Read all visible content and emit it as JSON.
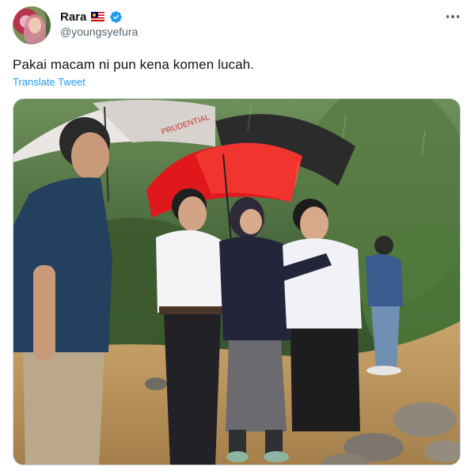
{
  "user": {
    "display_name": "Rara",
    "handle": "@youngsyefura",
    "flag_icon": "malaysia-flag-icon",
    "verified_icon": "verified-badge-icon",
    "verified_color": "#1d9bf0"
  },
  "tweet": {
    "text": "Pakai macam ni pun kena komen lucah.",
    "translate_label": "Translate Tweet"
  },
  "media": {
    "umbrella_brand_text": "PRUDENTIAL"
  },
  "colors": {
    "link": "#1d9bf0",
    "secondary_text": "#536471",
    "primary_text": "#0f1419"
  }
}
